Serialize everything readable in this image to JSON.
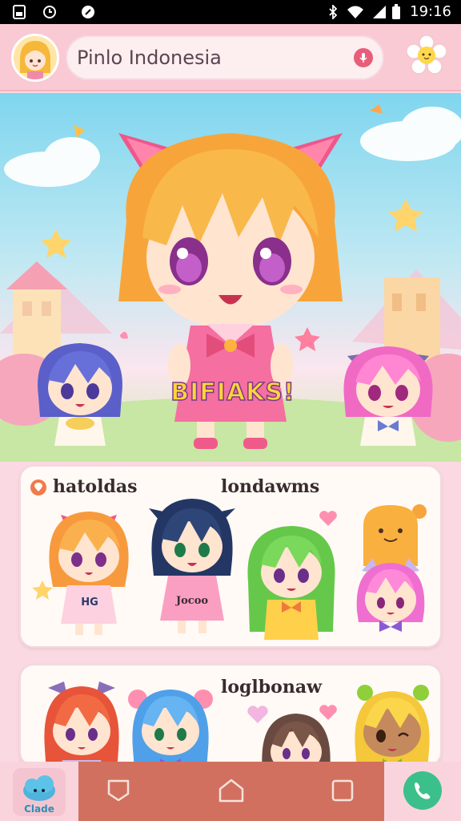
{
  "status_bar": {
    "left_icons": [
      "sim-icon",
      "clock-icon",
      "sync-icon"
    ],
    "right_icons": [
      "bluetooth-icon",
      "wifi-icon",
      "signal-icon",
      "battery-icon"
    ],
    "time": "19:16"
  },
  "header": {
    "search_text": "Pinlo Indonesia",
    "avatar": "blonde-girl-avatar",
    "mascot": "flower-mascot-icon"
  },
  "hero": {
    "title": "BIFIAKS!"
  },
  "card1": {
    "label_left": "hatoldas",
    "label_right": "londawms",
    "items": [
      {
        "shirt": "HG"
      },
      {
        "shirt": "Jocoo"
      },
      {
        "shirt": ""
      },
      {
        "shirt": ""
      }
    ]
  },
  "card2": {
    "label": "loglbonaw"
  },
  "nav": {
    "left_label": "Clade"
  },
  "colors": {
    "accent_pink": "#f9c9d4",
    "nav_mid": "#d27060",
    "call_green": "#3cc08b"
  }
}
